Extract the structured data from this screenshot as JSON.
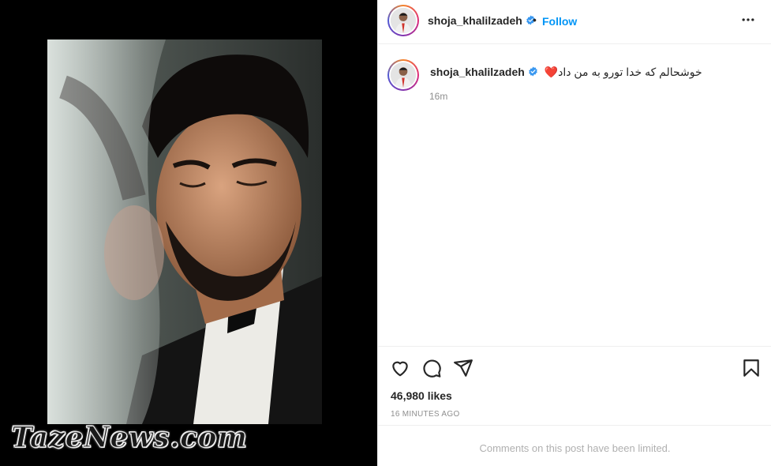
{
  "watermark": "TazeNews.com",
  "post": {
    "username": "shoja_khalilzadeh",
    "follow_label": "Follow",
    "separator": "•",
    "caption": "خوشحالم که خدا تورو به من داد",
    "caption_emoji": "❤️",
    "caption_time": "16m",
    "likes": "46,980 likes",
    "posted_ago": "16 MINUTES AGO",
    "comments_notice": "Comments on this post have been limited."
  },
  "icons": {
    "verified": "verified-badge-icon",
    "more": "more-options-icon",
    "like": "heart-icon",
    "comment": "comment-bubble-icon",
    "share": "paper-plane-icon",
    "save": "bookmark-icon"
  },
  "colors": {
    "link_blue": "#0095f6",
    "verified_blue": "#3897f0",
    "muted": "#8e8e8e",
    "heart": "#ed4956"
  }
}
